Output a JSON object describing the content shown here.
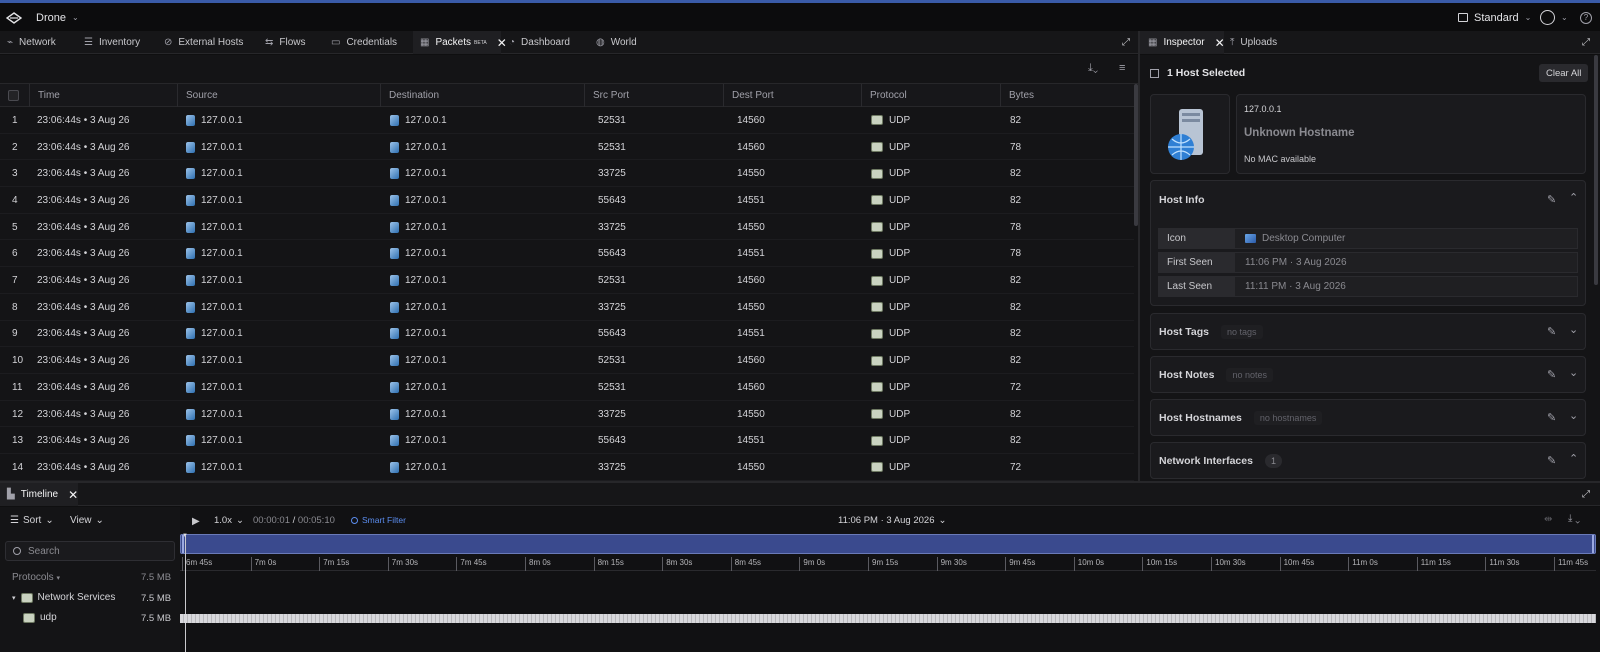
{
  "app": {
    "name": "Drone",
    "view_mode": "Standard"
  },
  "main_tabs": [
    {
      "label": "Network",
      "icon": "network-icon"
    },
    {
      "label": "Inventory",
      "icon": "inventory-icon"
    },
    {
      "label": "External Hosts",
      "icon": "external-hosts-icon"
    },
    {
      "label": "Flows",
      "icon": "flows-icon"
    },
    {
      "label": "Credentials",
      "icon": "credentials-icon"
    },
    {
      "label": "Packets",
      "badge": "BETA",
      "icon": "grid-icon",
      "active": true
    },
    {
      "label": "Dashboard",
      "icon": "dashboard-icon"
    },
    {
      "label": "World",
      "icon": "globe-icon"
    }
  ],
  "packets": {
    "columns": [
      "Time",
      "Source",
      "Destination",
      "Src Port",
      "Dest Port",
      "Protocol",
      "Bytes"
    ],
    "rows": [
      {
        "n": "1",
        "time": "23:06:44s • 3 Aug 26",
        "src": "127.0.0.1",
        "dst": "127.0.0.1",
        "sport": "52531",
        "dport": "14560",
        "proto": "UDP",
        "bytes": "82"
      },
      {
        "n": "2",
        "time": "23:06:44s • 3 Aug 26",
        "src": "127.0.0.1",
        "dst": "127.0.0.1",
        "sport": "52531",
        "dport": "14560",
        "proto": "UDP",
        "bytes": "78"
      },
      {
        "n": "3",
        "time": "23:06:44s • 3 Aug 26",
        "src": "127.0.0.1",
        "dst": "127.0.0.1",
        "sport": "33725",
        "dport": "14550",
        "proto": "UDP",
        "bytes": "82"
      },
      {
        "n": "4",
        "time": "23:06:44s • 3 Aug 26",
        "src": "127.0.0.1",
        "dst": "127.0.0.1",
        "sport": "55643",
        "dport": "14551",
        "proto": "UDP",
        "bytes": "82"
      },
      {
        "n": "5",
        "time": "23:06:44s • 3 Aug 26",
        "src": "127.0.0.1",
        "dst": "127.0.0.1",
        "sport": "33725",
        "dport": "14550",
        "proto": "UDP",
        "bytes": "78"
      },
      {
        "n": "6",
        "time": "23:06:44s • 3 Aug 26",
        "src": "127.0.0.1",
        "dst": "127.0.0.1",
        "sport": "55643",
        "dport": "14551",
        "proto": "UDP",
        "bytes": "78"
      },
      {
        "n": "7",
        "time": "23:06:44s • 3 Aug 26",
        "src": "127.0.0.1",
        "dst": "127.0.0.1",
        "sport": "52531",
        "dport": "14560",
        "proto": "UDP",
        "bytes": "82"
      },
      {
        "n": "8",
        "time": "23:06:44s • 3 Aug 26",
        "src": "127.0.0.1",
        "dst": "127.0.0.1",
        "sport": "33725",
        "dport": "14550",
        "proto": "UDP",
        "bytes": "82"
      },
      {
        "n": "9",
        "time": "23:06:44s • 3 Aug 26",
        "src": "127.0.0.1",
        "dst": "127.0.0.1",
        "sport": "55643",
        "dport": "14551",
        "proto": "UDP",
        "bytes": "82"
      },
      {
        "n": "10",
        "time": "23:06:44s • 3 Aug 26",
        "src": "127.0.0.1",
        "dst": "127.0.0.1",
        "sport": "52531",
        "dport": "14560",
        "proto": "UDP",
        "bytes": "82"
      },
      {
        "n": "11",
        "time": "23:06:44s • 3 Aug 26",
        "src": "127.0.0.1",
        "dst": "127.0.0.1",
        "sport": "52531",
        "dport": "14560",
        "proto": "UDP",
        "bytes": "72"
      },
      {
        "n": "12",
        "time": "23:06:44s • 3 Aug 26",
        "src": "127.0.0.1",
        "dst": "127.0.0.1",
        "sport": "33725",
        "dport": "14550",
        "proto": "UDP",
        "bytes": "82"
      },
      {
        "n": "13",
        "time": "23:06:44s • 3 Aug 26",
        "src": "127.0.0.1",
        "dst": "127.0.0.1",
        "sport": "55643",
        "dport": "14551",
        "proto": "UDP",
        "bytes": "82"
      },
      {
        "n": "14",
        "time": "23:06:44s • 3 Aug 26",
        "src": "127.0.0.1",
        "dst": "127.0.0.1",
        "sport": "33725",
        "dport": "14550",
        "proto": "UDP",
        "bytes": "72"
      }
    ]
  },
  "side_tabs": [
    {
      "label": "Inspector",
      "active": true
    },
    {
      "label": "Uploads"
    }
  ],
  "inspector": {
    "selected_label": "1 Host Selected",
    "clear_all": "Clear All",
    "ip": "127.0.0.1",
    "hostname": "Unknown Hostname",
    "mac": "No MAC available",
    "host_info_title": "Host Info",
    "fields": [
      {
        "k": "Icon",
        "v": "Desktop Computer"
      },
      {
        "k": "First Seen",
        "v": "11:06 PM  ·  3 Aug 2026"
      },
      {
        "k": "Last Seen",
        "v": "11:11 PM  ·  3 Aug 2026"
      }
    ],
    "sections": [
      {
        "title": "Host Tags",
        "chip": "no tags"
      },
      {
        "title": "Host Notes",
        "chip": "no notes"
      },
      {
        "title": "Host Hostnames",
        "chip": "no hostnames"
      },
      {
        "title": "Network Interfaces",
        "chip": "1"
      }
    ]
  },
  "timeline": {
    "tab": "Timeline",
    "sort": "Sort",
    "view": "View",
    "search_placeholder": "Search",
    "speed": "1.0x",
    "current": "00:00:01",
    "sep": " / ",
    "total": "00:05:10",
    "smart_filter": "Smart Filter",
    "date": "11:06 PM  ·  3 Aug 2026",
    "protocols_label": "Protocols",
    "protocols_size": "7.5 MB",
    "tree": [
      {
        "label": "Network Services",
        "size": "7.5 MB"
      },
      {
        "label": "udp",
        "size": "7.5 MB"
      }
    ],
    "ticks": [
      "6m 45s",
      "7m 0s",
      "7m 15s",
      "7m 30s",
      "7m 45s",
      "8m 0s",
      "8m 15s",
      "8m 30s",
      "8m 45s",
      "9m 0s",
      "9m 15s",
      "9m 30s",
      "9m 45s",
      "10m 0s",
      "10m 15s",
      "10m 30s",
      "10m 45s",
      "11m 0s",
      "11m 15s",
      "11m 30s",
      "11m 45s"
    ]
  },
  "colors": {
    "accent": "#3a5ba8",
    "smart_filter": "#5b8def",
    "overview_bar": "#3a4a8e"
  }
}
